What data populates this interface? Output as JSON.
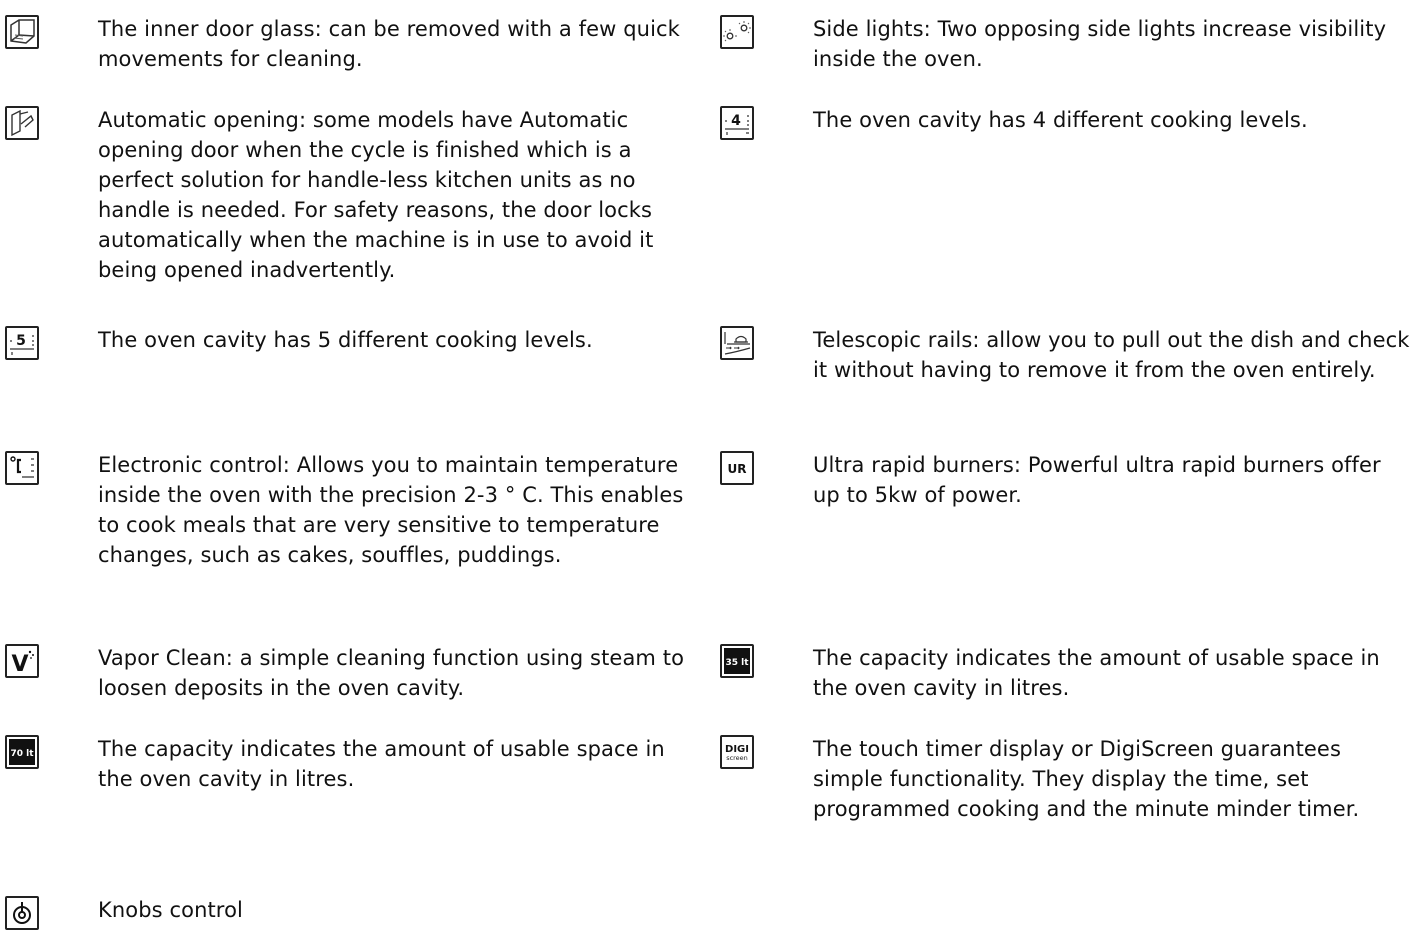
{
  "features": {
    "left": [
      {
        "icon": "door-glass-icon",
        "text": "The inner door glass: can be removed with a few quick movements for cleaning."
      },
      {
        "icon": "automatic-opening-door-icon",
        "text": "Automatic opening: some models have Automatic opening door when the cycle is finished which is a perfect solution for handle-less kitchen units as no handle is needed. For safety reasons, the door locks automatically when the machine is in use to avoid it being opened inadvertently."
      },
      {
        "icon": "five-levels-icon",
        "icon_label": "5",
        "text": "The oven cavity has 5 different cooking levels."
      },
      {
        "icon": "electronic-control-icon",
        "text": "Electronic control: Allows you to maintain temperature inside the oven with the precision 2-3 ° C. This enables to cook meals that are very sensitive to temperature changes, such as cakes, souffles, puddings."
      },
      {
        "icon": "vapor-clean-icon",
        "icon_label": "V",
        "text": "Vapor Clean: a simple cleaning function using steam to loosen deposits in the oven cavity."
      },
      {
        "icon": "capacity-70-icon",
        "icon_label": "70 lt",
        "text": "The capacity indicates the amount of usable space in the oven cavity in litres."
      },
      {
        "icon": "knob-icon",
        "text": "Knobs control"
      }
    ],
    "right": [
      {
        "icon": "side-lights-icon",
        "text": "Side lights: Two opposing side lights increase visibility inside the oven."
      },
      {
        "icon": "four-levels-icon",
        "icon_label": "4",
        "text": "The oven cavity has 4 different cooking levels."
      },
      {
        "icon": "telescopic-rails-icon",
        "text": "Telescopic rails: allow you to pull out the dish and check it without having to remove it from the oven entirely."
      },
      {
        "icon": "ultra-rapid-burner-icon",
        "icon_label": "UR",
        "text": "Ultra rapid burners: Powerful ultra rapid burners offer up to 5kw of power."
      },
      {
        "icon": "capacity-35-icon",
        "icon_label": "35 lt",
        "text": "The capacity indicates the amount of usable space in the oven cavity in litres."
      },
      {
        "icon": "digiscreen-icon",
        "icon_label": "DIGI",
        "icon_sublabel": "screen",
        "text": "The touch timer display or DigiScreen guarantees simple functionality. They display the time, set programmed cooking and the minute minder timer."
      }
    ]
  },
  "colors": {
    "text": "#111111",
    "icon_stroke": "#222222",
    "icon_dark_fill": "#111111",
    "icon_dark_text": "#ffffff"
  }
}
